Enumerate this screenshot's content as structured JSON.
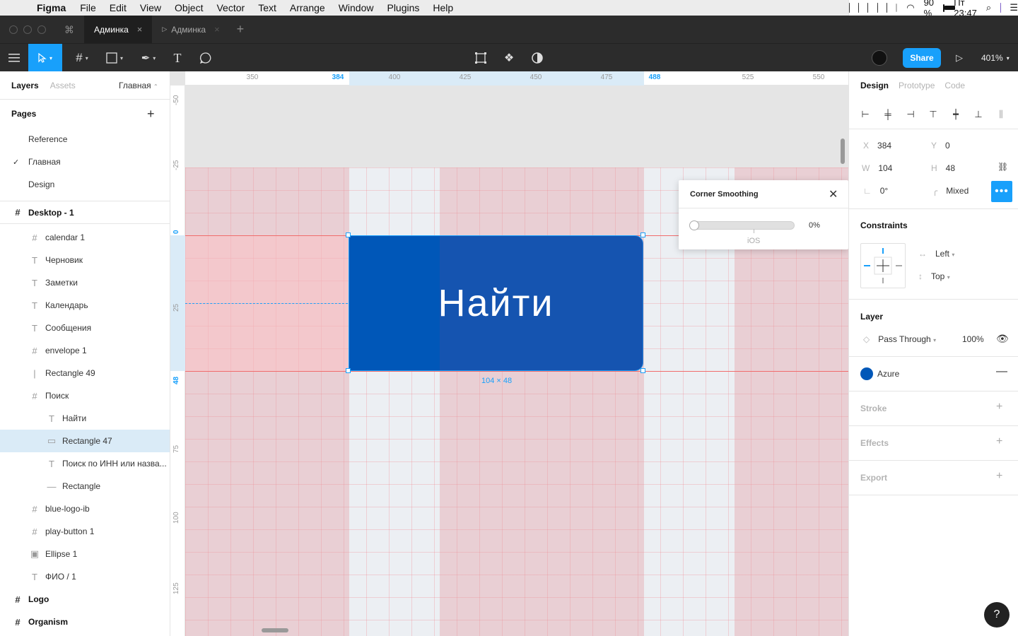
{
  "menubar": {
    "app": "Figma",
    "items": [
      "File",
      "Edit",
      "View",
      "Object",
      "Vector",
      "Text",
      "Arrange",
      "Window",
      "Plugins",
      "Help"
    ],
    "battery": "90 %",
    "clock": "Пт 23:47"
  },
  "tabs": {
    "active": "Админка",
    "second": "Админка"
  },
  "toolbar": {
    "share": "Share",
    "zoom": "401%"
  },
  "left_panel": {
    "tab_layers": "Layers",
    "tab_assets": "Assets",
    "page_selector": "Главная",
    "pages_header": "Pages",
    "pages": [
      "Reference",
      "Главная",
      "Design"
    ],
    "current_page_index": 1,
    "layers": [
      {
        "name": "Desktop - 1",
        "icon": "frame-icon",
        "glyph": "#",
        "level": 0,
        "top": true
      },
      {
        "name": "calendar 1",
        "icon": "frame-icon",
        "glyph": "#",
        "level": 1
      },
      {
        "name": "Черновик",
        "icon": "text-icon",
        "glyph": "T",
        "level": 1
      },
      {
        "name": "Заметки",
        "icon": "text-icon",
        "glyph": "T",
        "level": 1
      },
      {
        "name": "Календарь",
        "icon": "text-icon",
        "glyph": "T",
        "level": 1
      },
      {
        "name": "Сообщения",
        "icon": "text-icon",
        "glyph": "T",
        "level": 1
      },
      {
        "name": "envelope 1",
        "icon": "frame-icon",
        "glyph": "#",
        "level": 1
      },
      {
        "name": "Rectangle 49",
        "icon": "line-icon",
        "glyph": "|",
        "level": 1
      },
      {
        "name": "Поиск",
        "icon": "frame-icon",
        "glyph": "#",
        "level": 1
      },
      {
        "name": "Найти",
        "icon": "text-icon",
        "glyph": "T",
        "level": 2
      },
      {
        "name": "Rectangle 47",
        "icon": "rectangle-icon",
        "glyph": "▭",
        "level": 2,
        "selected": true
      },
      {
        "name": "Поиск по ИНН или назва...",
        "icon": "text-icon",
        "glyph": "T",
        "level": 2
      },
      {
        "name": "Rectangle",
        "icon": "line-icon",
        "glyph": "—",
        "level": 2
      },
      {
        "name": "blue-logo-ib",
        "icon": "frame-icon",
        "glyph": "#",
        "level": 1
      },
      {
        "name": "play-button 1",
        "icon": "frame-icon",
        "glyph": "#",
        "level": 1
      },
      {
        "name": "Ellipse 1",
        "icon": "image-icon",
        "glyph": "▣",
        "level": 1
      },
      {
        "name": "ФИО / 1",
        "icon": "text-icon",
        "glyph": "T",
        "level": 1
      },
      {
        "name": "Logo",
        "icon": "frame-icon",
        "glyph": "#",
        "level": 0,
        "top": true
      },
      {
        "name": "Organism",
        "icon": "frame-icon",
        "glyph": "#",
        "level": 0,
        "top": true
      }
    ]
  },
  "canvas": {
    "ruler_x": [
      "350",
      "384",
      "400",
      "425",
      "450",
      "475",
      "488",
      "525",
      "550"
    ],
    "ruler_y": [
      "-50",
      "-25",
      "0",
      "25",
      "48",
      "75",
      "100",
      "125"
    ],
    "button_label": "Найти",
    "size_label": "104 × 48"
  },
  "popover": {
    "title": "Corner Smoothing",
    "value": "0%",
    "preset": "iOS",
    "smoothing": 0
  },
  "right_panel": {
    "tab_design": "Design",
    "tab_prototype": "Prototype",
    "tab_code": "Code",
    "x_label": "X",
    "x": "384",
    "y_label": "Y",
    "y": "0",
    "w_label": "W",
    "w": "104",
    "h_label": "H",
    "h": "48",
    "rotation": "0°",
    "radius": "Mixed",
    "constraints_header": "Constraints",
    "constraint_h": "Left",
    "constraint_v": "Top",
    "layer_header": "Layer",
    "blend": "Pass Through",
    "opacity": "100%",
    "fill_name": "Azure",
    "fill_color": "#0057b8",
    "stroke_header": "Stroke",
    "effects_header": "Effects",
    "export_header": "Export"
  },
  "help": "?"
}
